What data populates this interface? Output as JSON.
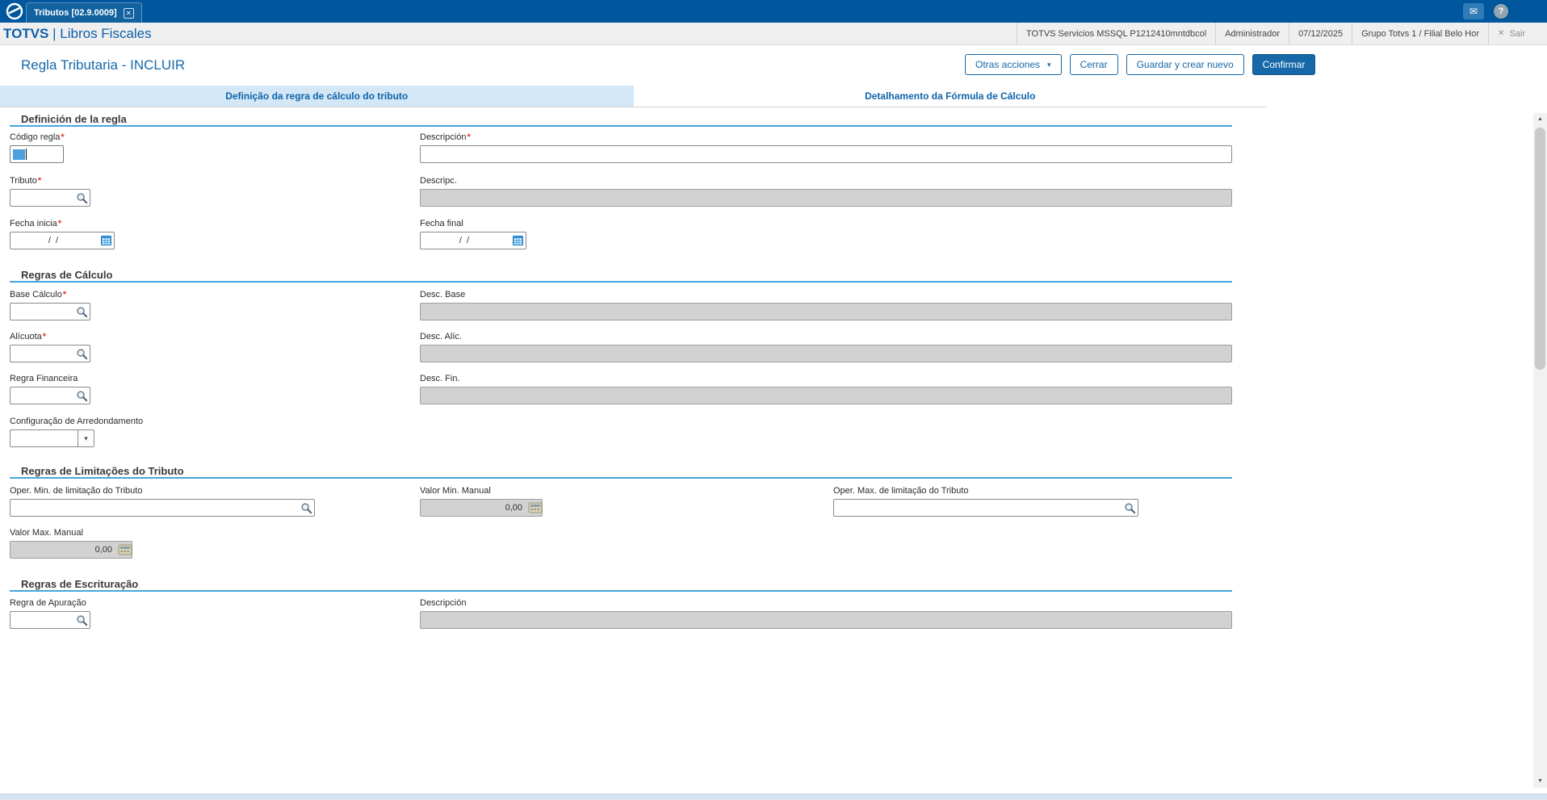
{
  "icons": {
    "close_tab": "✕",
    "mail": "✉",
    "help": "?",
    "sair_x": "✕",
    "caret_down": "▾",
    "select_chevron": "▾",
    "scroll_up": "▲",
    "scroll_down": "▼"
  },
  "marks": {
    "required": "*"
  },
  "topbar": {
    "window_tab": "Tributos [02.9.0009]"
  },
  "header": {
    "brand_primary": "TOTVS",
    "brand_separator": "|",
    "brand_secondary": "Libros Fiscales",
    "environment": "TOTVS Servicios MSSQL P1212410mntdbcol",
    "user": "Administrador",
    "date": "07/12/2025",
    "company": "Grupo Totvs 1 / Filial Belo Hor",
    "exit_label": "Sair"
  },
  "toolbar": {
    "page_title": "Regla Tributaria - INCLUIR",
    "other_actions_label": "Otras acciones",
    "close_label": "Cerrar",
    "save_new_label": "Guardar y crear nuevo",
    "confirm_label": "Confirmar"
  },
  "tabs": {
    "definition": "Definição da regra de cálculo do tributo",
    "detail": "Detalhamento da Fórmula de Cálculo"
  },
  "sections": {
    "definition_title": "Definición de la regla",
    "calculo_title": "Regras de Cálculo",
    "limitacoes_title": "Regras de Limitações do Tributo",
    "escrituracao_title": "Regras de Escrituração"
  },
  "fields": {
    "codigo_regla": {
      "label": "Código regla",
      "value": ""
    },
    "descripcion": {
      "label": "Descripción",
      "value": ""
    },
    "tributo": {
      "label": "Tributo",
      "value": ""
    },
    "descripc": {
      "label": "Descripc.",
      "value": ""
    },
    "fecha_inicia": {
      "label": "Fecha inicia",
      "value": "/  /"
    },
    "fecha_final": {
      "label": "Fecha final",
      "value": "/  /"
    },
    "base_calculo": {
      "label": "Base Cálculo",
      "value": ""
    },
    "desc_base": {
      "label": "Desc. Base",
      "value": ""
    },
    "alicuota": {
      "label": "Alícuota",
      "value": ""
    },
    "desc_alic": {
      "label": "Desc. Alíc.",
      "value": ""
    },
    "regra_financeira": {
      "label": "Regra Financeira",
      "value": ""
    },
    "desc_fin": {
      "label": "Desc. Fin.",
      "value": ""
    },
    "config_arredondamento": {
      "label": "Configuração de Arredondamento",
      "value": ""
    },
    "oper_min": {
      "label": "Oper. Min. de limitação do Tributo",
      "value": ""
    },
    "valor_min": {
      "label": "Valor Min. Manual",
      "value": "0,00"
    },
    "oper_max": {
      "label": "Oper. Max. de limitação do Tributo",
      "value": ""
    },
    "valor_max": {
      "label": "Valor Max. Manual",
      "value": "0,00"
    },
    "regra_apuracao": {
      "label": "Regra de Apuração",
      "value": ""
    },
    "descripcion_escrituracao": {
      "label": "Descripción",
      "value": ""
    }
  },
  "colors": {
    "topbar": "#00579d",
    "accent": "#1568a9",
    "section_line": "#45a7dd",
    "tab_active_bg": "#d3e7f6",
    "required": "#e03c31",
    "disabled_bg": "#d2d2d2"
  }
}
